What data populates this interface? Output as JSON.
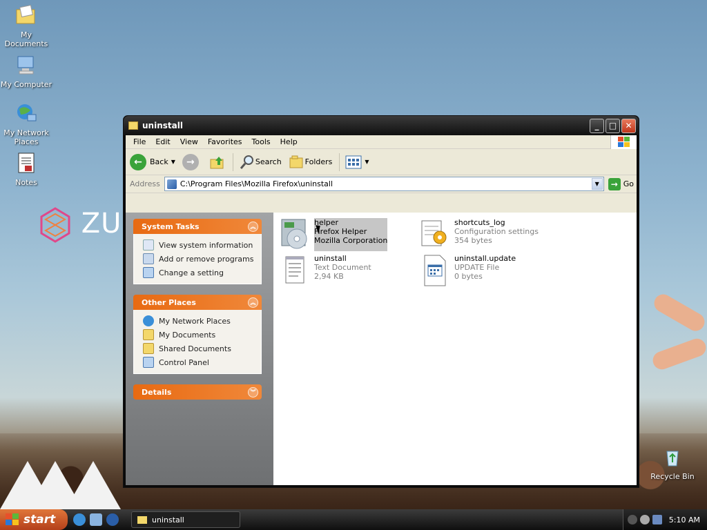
{
  "desktop": {
    "icons": [
      {
        "label": "My Documents"
      },
      {
        "label": "My Computer"
      },
      {
        "label": "My Network Places"
      },
      {
        "label": "Notes"
      },
      {
        "label": "Recycle Bin"
      }
    ],
    "logo_text": "ZUI"
  },
  "window": {
    "title": "uninstall",
    "menu": [
      "File",
      "Edit",
      "View",
      "Favorites",
      "Tools",
      "Help"
    ],
    "toolbar": {
      "back": "Back",
      "search": "Search",
      "folders": "Folders"
    },
    "address": {
      "label": "Address",
      "value": "C:\\Program Files\\Mozilla Firefox\\uninstall",
      "go": "Go"
    }
  },
  "taskpane": {
    "system_tasks": {
      "title": "System Tasks",
      "items": [
        "View system information",
        "Add or remove programs",
        "Change a setting"
      ]
    },
    "other_places": {
      "title": "Other Places",
      "items": [
        "My Network Places",
        "My Documents",
        "Shared Documents",
        "Control Panel"
      ]
    },
    "details": {
      "title": "Details"
    }
  },
  "files": [
    {
      "name": "helper",
      "line2": "Firefox Helper",
      "line3": "Mozilla Corporation",
      "icon": "installer-cd-icon",
      "selected": true
    },
    {
      "name": "shortcuts_log",
      "line2": "Configuration settings",
      "line3": "354 bytes",
      "icon": "config-file-icon"
    },
    {
      "name": "uninstall",
      "line2": "Text Document",
      "line3": "2,94 KB",
      "icon": "text-document-icon"
    },
    {
      "name": "uninstall.update",
      "line2": "UPDATE File",
      "line3": "0 bytes",
      "icon": "generic-file-icon"
    }
  ],
  "taskbar": {
    "start": "start",
    "task": "uninstall",
    "clock": "5:10 AM"
  },
  "colors": {
    "accent_orange": "#e86a12",
    "titlebar": "#1a1a1a",
    "selection": "#c6c6c6"
  }
}
